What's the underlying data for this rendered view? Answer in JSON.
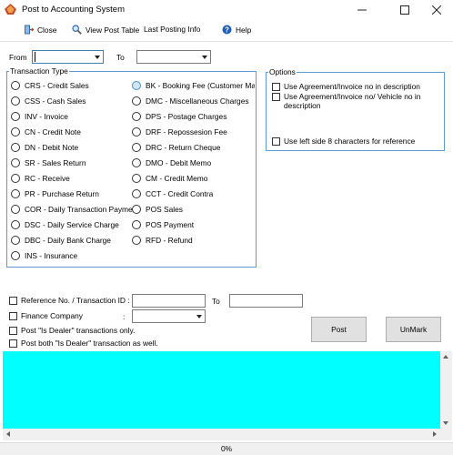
{
  "window": {
    "title": "Post to Accounting System",
    "controls": [
      "minimize-icon",
      "maximize-icon",
      "close-icon"
    ]
  },
  "toolbar": {
    "close_label": "Close",
    "view_post_table_label": "View Post Table",
    "last_posting_info_label": "Last Posting Info",
    "help_label": "Help"
  },
  "filter": {
    "from_label": "From",
    "to_label": "To"
  },
  "transaction_type": {
    "title": "Transaction Type",
    "left_column": [
      "CRS - Credit Sales",
      "CSS - Cash Sales",
      "INV - Invoice",
      "CN - Credit Note",
      "DN - Debit Note",
      "SR - Sales Return",
      "RC - Receive",
      "PR - Purchase Return",
      "COR - Daily Transaction Payment",
      "DSC - Daily Service Charge",
      "DBC - Daily Bank Charge",
      "INS - Insurance"
    ],
    "right_column": [
      "BK - Booking Fee (Customer Maste",
      "DMC - Miscellaneous Charges",
      "DPS - Postage Charges",
      "DRF - Repossesion Fee",
      "DRC - Return Cheque",
      "DMO - Debit Memo",
      "CM - Credit Memo",
      "CCT - Credit Contra",
      "POS Sales",
      "POS Payment",
      "RFD - Refund"
    ]
  },
  "options": {
    "title": "Options",
    "items": [
      "Use Agreement/Invoice no in description",
      "Use Agreement/Invoice no/ Vehicle no in description",
      "Use left side 8 characters for reference"
    ]
  },
  "reference": {
    "label": "Reference No. / Transaction ID :",
    "to_label": "To"
  },
  "finance_company": {
    "label": "Finance Company",
    "colon": ":"
  },
  "dealer": {
    "only_label": "Post \"Is Dealer\" transactions only.",
    "both_label": "Post both \"Is Dealer\" transaction as well."
  },
  "buttons": {
    "post_label": "Post",
    "unmark_label": "UnMark"
  },
  "grid": {
    "background": "#00ffff"
  },
  "progress": {
    "value": 0,
    "text": "0%"
  }
}
